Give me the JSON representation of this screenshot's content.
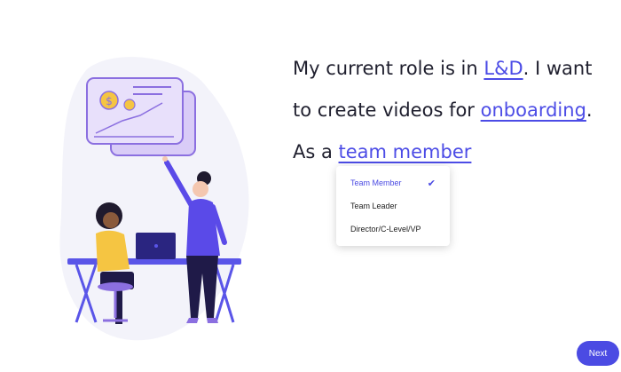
{
  "sentence": {
    "line1_prefix": "My current role is in ",
    "line1_choice": "L&D",
    "line1_suffix": ". I want",
    "line2_prefix": "to create videos for ",
    "line2_choice": "onboarding",
    "line2_suffix": ".",
    "line3_prefix": "As a ",
    "line3_choice": "team member"
  },
  "dropdown": {
    "options": [
      {
        "label": "Team Member",
        "selected": true
      },
      {
        "label": "Team Leader",
        "selected": false
      },
      {
        "label": "Director/C-Level/VP",
        "selected": false
      }
    ],
    "check_icon": "✔"
  },
  "next_button": {
    "label": "Next"
  },
  "colors": {
    "accent": "#4b4be3",
    "text": "#1f1f2e",
    "illustration_bg": "#f3f3fa"
  }
}
